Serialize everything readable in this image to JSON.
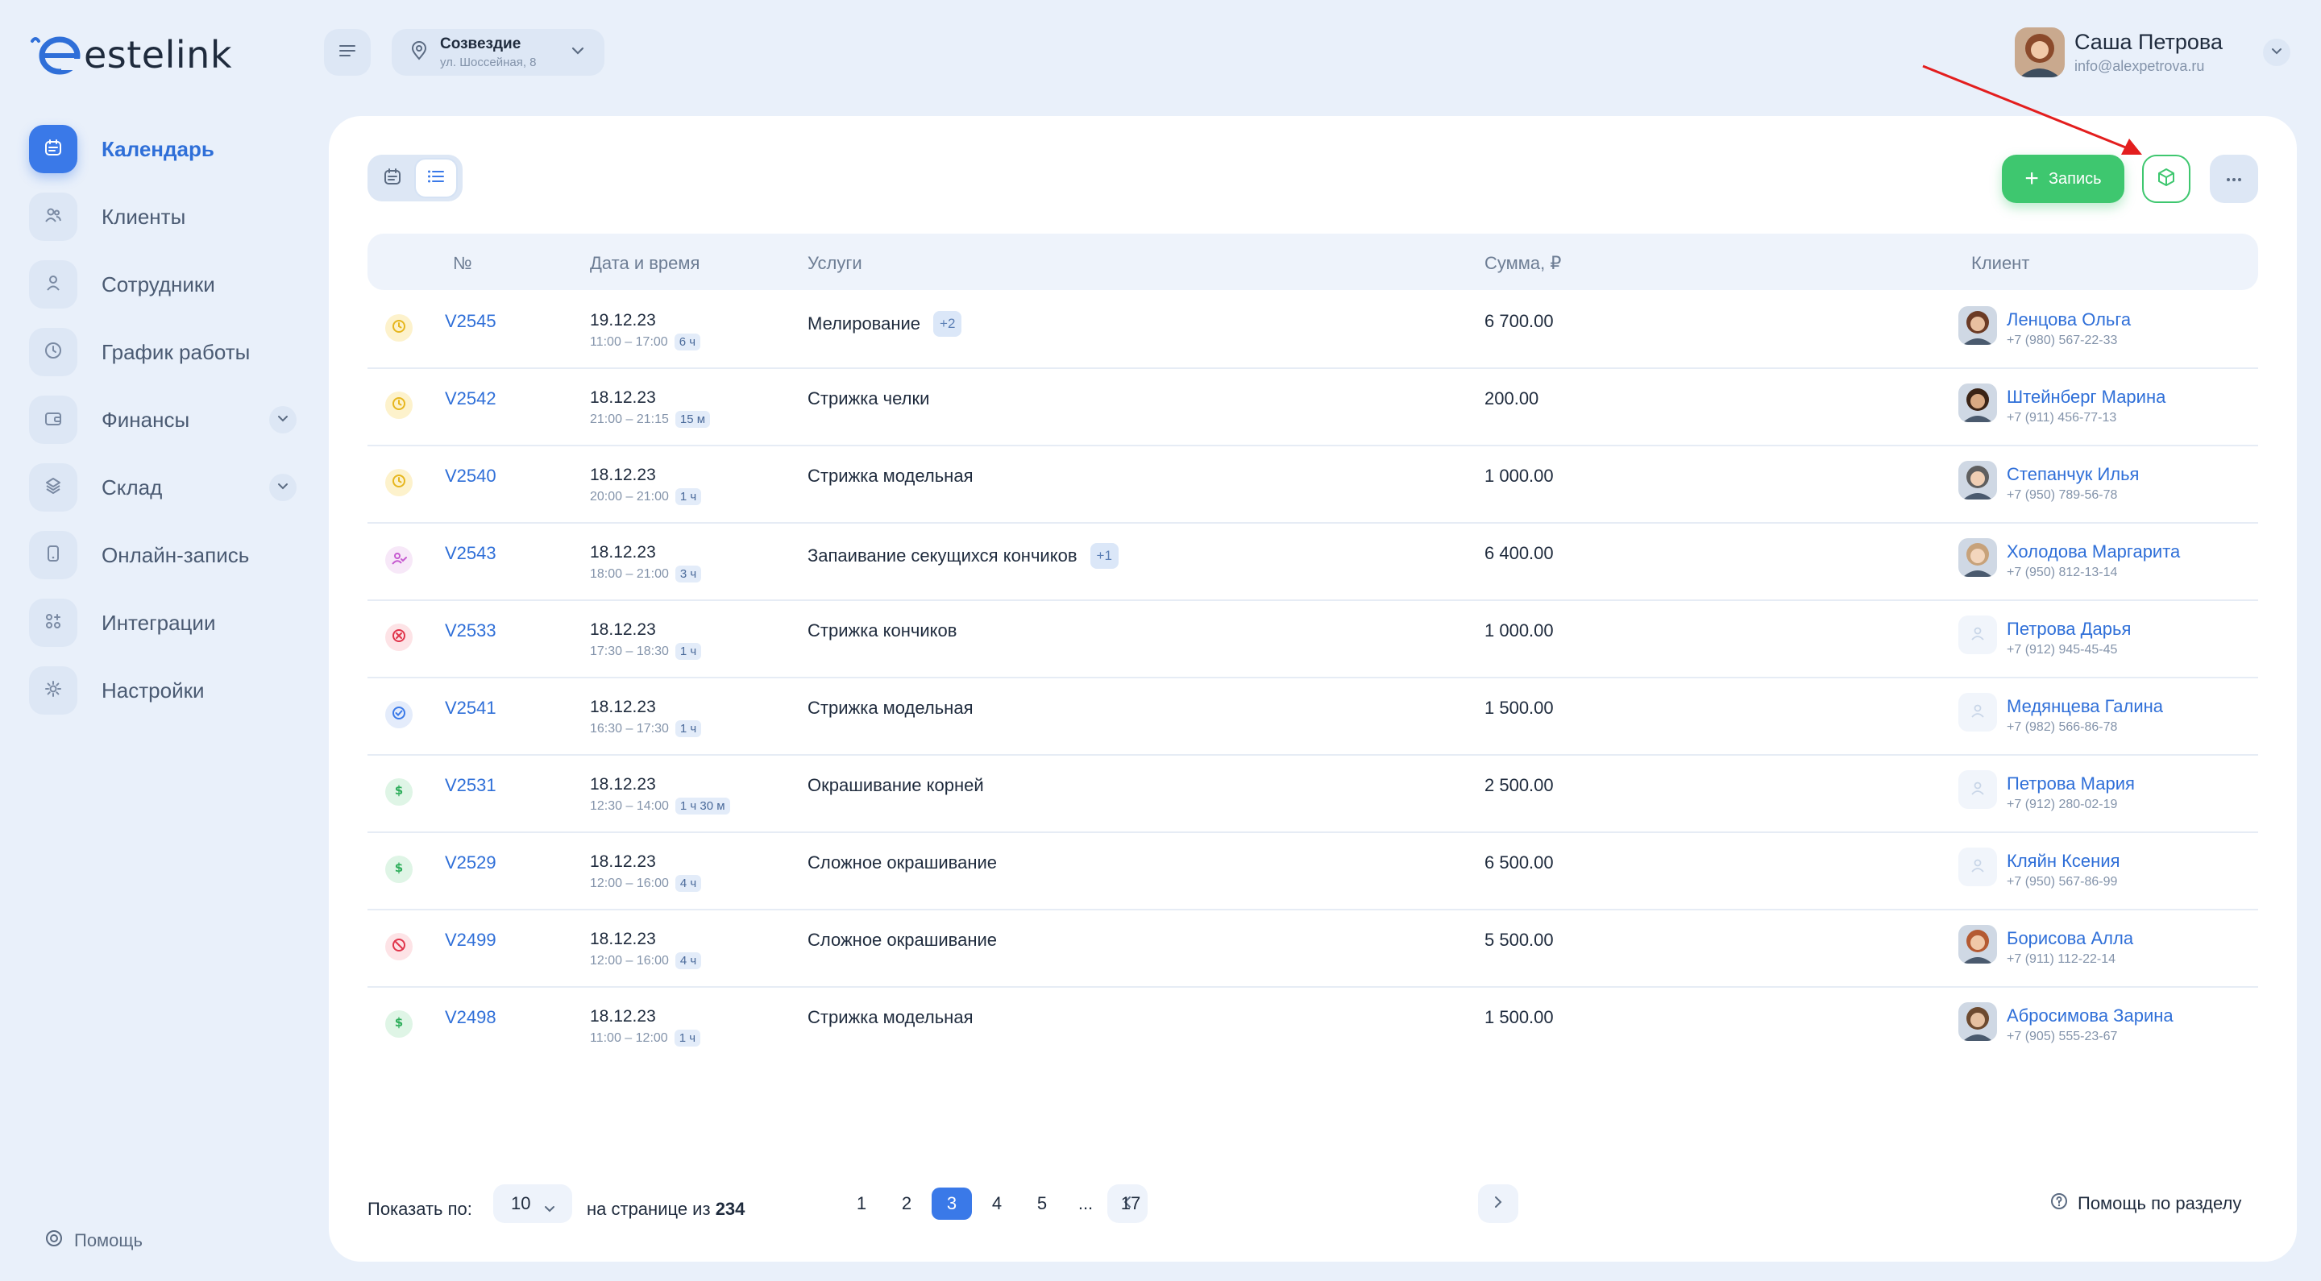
{
  "app": {
    "logo_text": "estelink"
  },
  "sidebar": {
    "items": [
      {
        "label": "Календарь",
        "icon": "calendar-icon",
        "active": true
      },
      {
        "label": "Клиенты",
        "icon": "clients-icon"
      },
      {
        "label": "Сотрудники",
        "icon": "employee-icon"
      },
      {
        "label": "График работы",
        "icon": "clock-icon"
      },
      {
        "label": "Финансы",
        "icon": "wallet-icon",
        "expandable": true
      },
      {
        "label": "Склад",
        "icon": "warehouse-icon",
        "expandable": true
      },
      {
        "label": "Онлайн-запись",
        "icon": "phone-icon"
      },
      {
        "label": "Интеграции",
        "icon": "integrations-icon"
      },
      {
        "label": "Настройки",
        "icon": "settings-icon"
      }
    ],
    "help_label": "Помощь"
  },
  "topbar": {
    "branch_name": "Созвездие",
    "branch_address": "ул. Шоссейная, 8"
  },
  "user": {
    "name": "Саша Петрова",
    "email": "info@alexpetrova.ru"
  },
  "toolbar": {
    "add_label": "Запись",
    "more_label": "···"
  },
  "table": {
    "headers": {
      "number": "№",
      "datetime": "Дата и время",
      "services": "Услуги",
      "sum": "Сумма, ₽",
      "client": "Клиент"
    },
    "rows": [
      {
        "status": "pending",
        "id": "V2545",
        "date": "19.12.23",
        "time": "11:00 – 17:00",
        "duration": "6 ч",
        "service": "Мелирование",
        "extra": "+2",
        "sum": "6 700.00",
        "client": "Ленцова Ольга",
        "phone": "+7 (980) 567-22-33",
        "avatar": "photo"
      },
      {
        "status": "pending",
        "id": "V2542",
        "date": "18.12.23",
        "time": "21:00 – 21:15",
        "duration": "15 м",
        "service": "Стрижка челки",
        "extra": "",
        "sum": "200.00",
        "client": "Штейнберг Марина",
        "phone": "+7 (911) 456-77-13",
        "avatar": "photo"
      },
      {
        "status": "pending",
        "id": "V2540",
        "date": "18.12.23",
        "time": "20:00 – 21:00",
        "duration": "1 ч",
        "service": "Стрижка модельная",
        "extra": "",
        "sum": "1 000.00",
        "client": "Степанчук Илья",
        "phone": "+7 (950) 789-56-78",
        "avatar": "photo"
      },
      {
        "status": "arrived",
        "id": "V2543",
        "date": "18.12.23",
        "time": "18:00 – 21:00",
        "duration": "3 ч",
        "service": "Запаивание секущихся кончиков",
        "extra": "+1",
        "sum": "6 400.00",
        "client": "Холодова Маргарита",
        "phone": "+7 (950) 812-13-14",
        "avatar": "photo"
      },
      {
        "status": "cancelled",
        "id": "V2533",
        "date": "18.12.23",
        "time": "17:30 – 18:30",
        "duration": "1 ч",
        "service": "Стрижка кончиков",
        "extra": "",
        "sum": "1 000.00",
        "client": "Петрова Дарья",
        "phone": "+7 (912) 945-45-45",
        "avatar": "empty"
      },
      {
        "status": "confirmed",
        "id": "V2541",
        "date": "18.12.23",
        "time": "16:30 – 17:30",
        "duration": "1 ч",
        "service": "Стрижка модельная",
        "extra": "",
        "sum": "1 500.00",
        "client": "Медянцева Галина",
        "phone": "+7 (982) 566-86-78",
        "avatar": "empty"
      },
      {
        "status": "paid",
        "id": "V2531",
        "date": "18.12.23",
        "time": "12:30 – 14:00",
        "duration": "1 ч 30 м",
        "service": "Окрашивание корней",
        "extra": "",
        "sum": "2 500.00",
        "client": "Петрова Мария",
        "phone": "+7 (912) 280-02-19",
        "avatar": "empty"
      },
      {
        "status": "paid",
        "id": "V2529",
        "date": "18.12.23",
        "time": "12:00 – 16:00",
        "duration": "4 ч",
        "service": "Сложное окрашивание",
        "extra": "",
        "sum": "6 500.00",
        "client": "Кляйн Ксения",
        "phone": "+7 (950) 567-86-99",
        "avatar": "empty"
      },
      {
        "status": "noshow",
        "id": "V2499",
        "date": "18.12.23",
        "time": "12:00 – 16:00",
        "duration": "4 ч",
        "service": "Сложное окрашивание",
        "extra": "",
        "sum": "5 500.00",
        "client": "Борисова Алла",
        "phone": "+7 (911) 112-22-14",
        "avatar": "photo"
      },
      {
        "status": "paid",
        "id": "V2498",
        "date": "18.12.23",
        "time": "11:00 – 12:00",
        "duration": "1 ч",
        "service": "Стрижка модельная",
        "extra": "",
        "sum": "1 500.00",
        "client": "Абросимова Зарина",
        "phone": "+7 (905) 555-23-67",
        "avatar": "photo"
      }
    ]
  },
  "footer": {
    "show_label": "Показать по:",
    "per_page": "10",
    "of_label": "на странице из",
    "total": "234",
    "pages": [
      "1",
      "2",
      "3",
      "4",
      "5",
      "...",
      "17"
    ],
    "current_page": "3",
    "help_label": "Помощь по разделу"
  },
  "colors": {
    "accent": "#3a79e8",
    "success": "#3ec76f",
    "background": "#e9f0fa",
    "annotation_arrow": "#e31e1e"
  }
}
